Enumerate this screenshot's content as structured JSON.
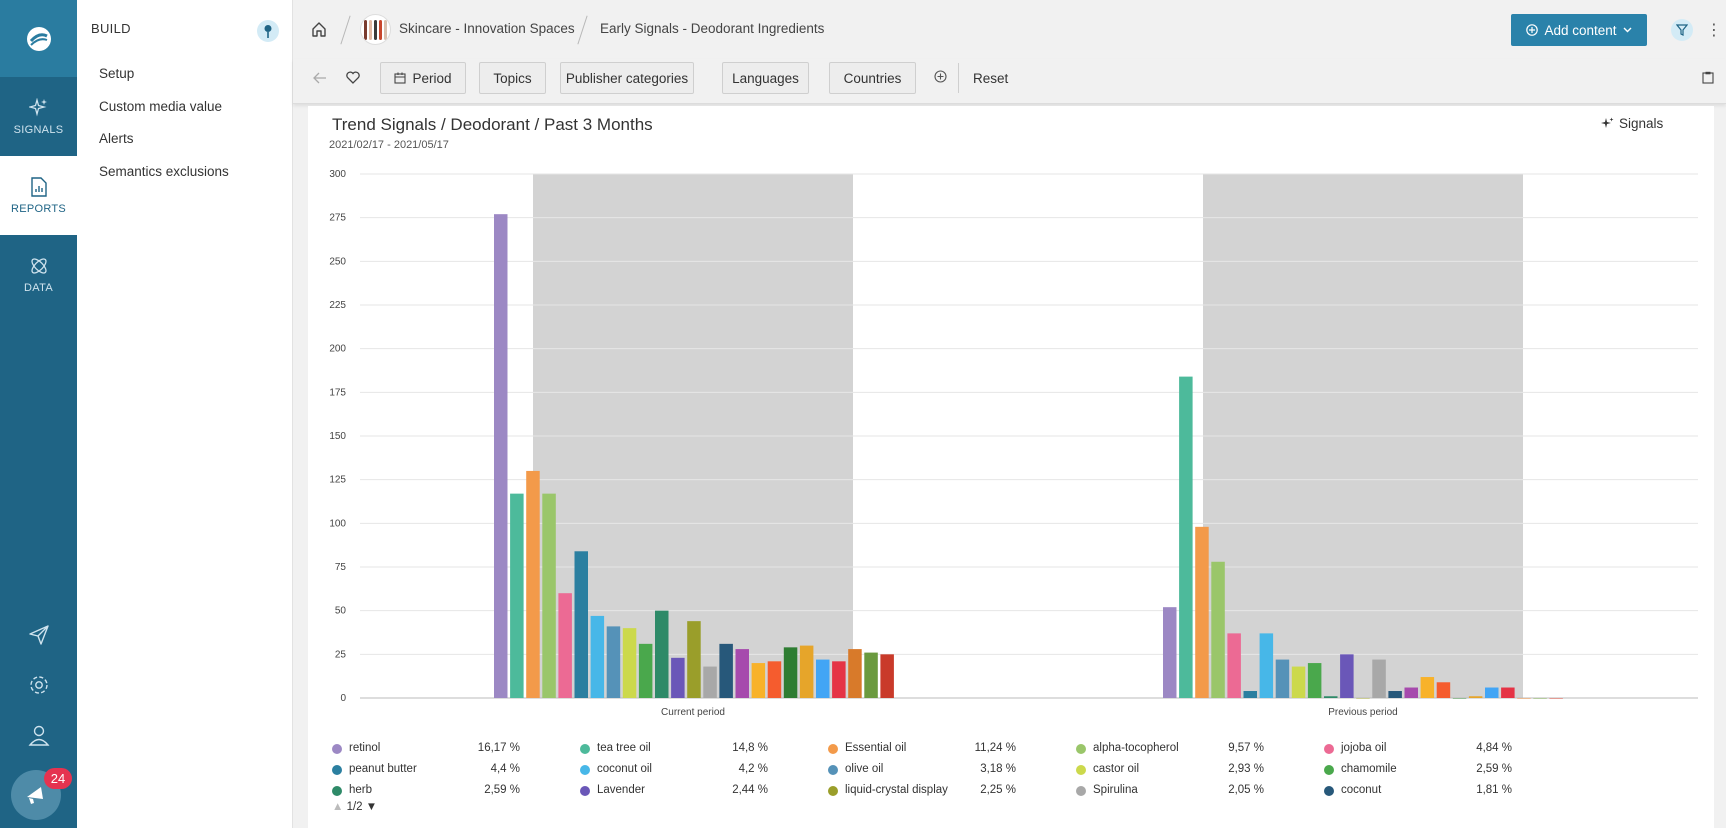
{
  "rail": {
    "items": [
      {
        "label": "SIGNALS"
      },
      {
        "label": "REPORTS"
      },
      {
        "label": "DATA"
      }
    ],
    "chat_badge": "24"
  },
  "sidebar": {
    "title": "BUILD",
    "links": [
      "Setup",
      "Custom media value",
      "Alerts",
      "Semantics exclusions"
    ]
  },
  "header": {
    "breadcrumbs": [
      "Skincare - Innovation Spaces",
      "Early Signals - Deodorant Ingredients"
    ],
    "add_content_label": "Add content"
  },
  "filters": {
    "buttons": [
      "Period",
      "Topics",
      "Publisher categories",
      "Languages",
      "Countries"
    ],
    "reset_label": "Reset"
  },
  "card": {
    "title": "Trend Signals / Deodorant / Past 3 Months",
    "date_range": "2021/02/17 - 2021/05/17",
    "signals_label": "Signals",
    "pager": "1/2"
  },
  "colors": {
    "rail": "#1f6485",
    "accent": "#2a82aa",
    "shade": "#d3d3d3"
  },
  "chart_data": {
    "type": "bar",
    "categories": [
      "Current period",
      "Previous period"
    ],
    "ylim": [
      0,
      300
    ],
    "yticks": [
      0,
      25,
      50,
      75,
      100,
      125,
      150,
      175,
      200,
      225,
      250,
      275,
      300
    ],
    "series": [
      {
        "name": "retinol",
        "color": "#9c88c4",
        "values": [
          277,
          52
        ],
        "pct": "16,17 %"
      },
      {
        "name": "tea tree oil",
        "color": "#4dba9b",
        "values": [
          117,
          184
        ],
        "pct": "14,8 %"
      },
      {
        "name": "Essential oil",
        "color": "#f39a4a",
        "values": [
          130,
          98
        ],
        "pct": "11,24 %"
      },
      {
        "name": "alpha-tocopherol",
        "color": "#9ac66a",
        "values": [
          117,
          78
        ],
        "pct": "9,57 %"
      },
      {
        "name": "jojoba oil",
        "color": "#ec6a94",
        "values": [
          60,
          37
        ],
        "pct": "4,84 %"
      },
      {
        "name": "peanut butter",
        "color": "#2b7fa0",
        "values": [
          84,
          4
        ],
        "pct": "4,4 %"
      },
      {
        "name": "coconut oil",
        "color": "#47b7e8",
        "values": [
          47,
          37
        ],
        "pct": "4,2 %"
      },
      {
        "name": "olive oil",
        "color": "#5592b8",
        "values": [
          41,
          22
        ],
        "pct": "3,18 %"
      },
      {
        "name": "castor oil",
        "color": "#ccd94c",
        "values": [
          40,
          18
        ],
        "pct": "2,93 %"
      },
      {
        "name": "chamomile",
        "color": "#4aa84c",
        "values": [
          31,
          20
        ],
        "pct": "2,59 %"
      },
      {
        "name": "herb",
        "color": "#2e8a68",
        "values": [
          50,
          1
        ],
        "pct": "2,59 %"
      },
      {
        "name": "Lavender",
        "color": "#6a57b8",
        "values": [
          23,
          25
        ],
        "pct": "2,44 %"
      },
      {
        "name": "liquid-crystal display",
        "color": "#9a9e2a",
        "values": [
          44,
          0
        ],
        "pct": "2,25 %"
      },
      {
        "name": "Spirulina",
        "color": "#a8a8a8",
        "values": [
          18,
          22
        ],
        "pct": "2,05 %"
      },
      {
        "name": "coconut",
        "color": "#27587a",
        "values": [
          31,
          4
        ],
        "pct": "1,81 %"
      },
      {
        "name": "",
        "color": "#a64aad",
        "values": [
          28,
          6
        ],
        "pct": ""
      },
      {
        "name": "",
        "color": "#f8b22a",
        "values": [
          20,
          12
        ],
        "pct": ""
      },
      {
        "name": "",
        "color": "#f55c2e",
        "values": [
          21,
          9
        ],
        "pct": ""
      },
      {
        "name": "",
        "color": "#2e7d32",
        "values": [
          29,
          0
        ],
        "pct": ""
      },
      {
        "name": "",
        "color": "#e6a52a",
        "values": [
          30,
          1
        ],
        "pct": ""
      },
      {
        "name": "",
        "color": "#42a5f5",
        "values": [
          22,
          6
        ],
        "pct": ""
      },
      {
        "name": "",
        "color": "#e53345",
        "values": [
          21,
          6
        ],
        "pct": ""
      },
      {
        "name": "",
        "color": "#d87a2a",
        "values": [
          28,
          0
        ],
        "pct": ""
      },
      {
        "name": "",
        "color": "#6b9a3f",
        "values": [
          26,
          0
        ],
        "pct": ""
      },
      {
        "name": "",
        "color": "#c93a2a",
        "values": [
          25,
          0
        ],
        "pct": ""
      }
    ]
  }
}
